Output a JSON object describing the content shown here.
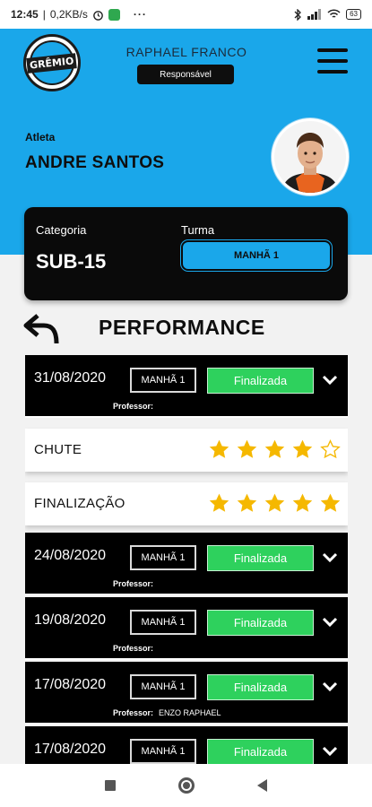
{
  "status_bar": {
    "time": "12:45",
    "network_speed": "0,2KB/s",
    "more": "···",
    "battery": "63"
  },
  "header": {
    "logo_text": "GRÊMIO",
    "user_name": "RAPHAEL FRANCO",
    "user_role": "Responsável",
    "athlete_label": "Atleta",
    "athlete_name": "ANDRE SANTOS"
  },
  "category_card": {
    "category_label": "Categoria",
    "category_value": "SUB-15",
    "class_label": "Turma",
    "class_value": "MANHÃ 1"
  },
  "performance": {
    "title": "PERFORMANCE",
    "professor_label": "Professor:",
    "sessions": [
      {
        "date": "31/08/2020",
        "class": "MANHÃ 1",
        "status": "Finalizada",
        "professor": ""
      },
      {
        "date": "24/08/2020",
        "class": "MANHÃ 1",
        "status": "Finalizada",
        "professor": ""
      },
      {
        "date": "19/08/2020",
        "class": "MANHÃ 1",
        "status": "Finalizada",
        "professor": ""
      },
      {
        "date": "17/08/2020",
        "class": "MANHÃ 1",
        "status": "Finalizada",
        "professor": "ENZO RAPHAEL"
      },
      {
        "date": "17/08/2020",
        "class": "MANHÃ 1",
        "status": "Finalizada",
        "professor": ""
      }
    ],
    "skills": [
      {
        "name": "CHUTE",
        "rating": 4,
        "max": 5
      },
      {
        "name": "FINALIZAÇÃO",
        "rating": 5,
        "max": 5
      }
    ]
  },
  "colors": {
    "brand_blue": "#1aa7ea",
    "status_green": "#2ed15d",
    "star_gold": "#f5b800"
  },
  "icons": [
    "back-arrow-icon",
    "menu-icon",
    "chevron-down-icon",
    "star-icon",
    "nav-recents-icon",
    "nav-home-icon",
    "nav-back-icon"
  ]
}
